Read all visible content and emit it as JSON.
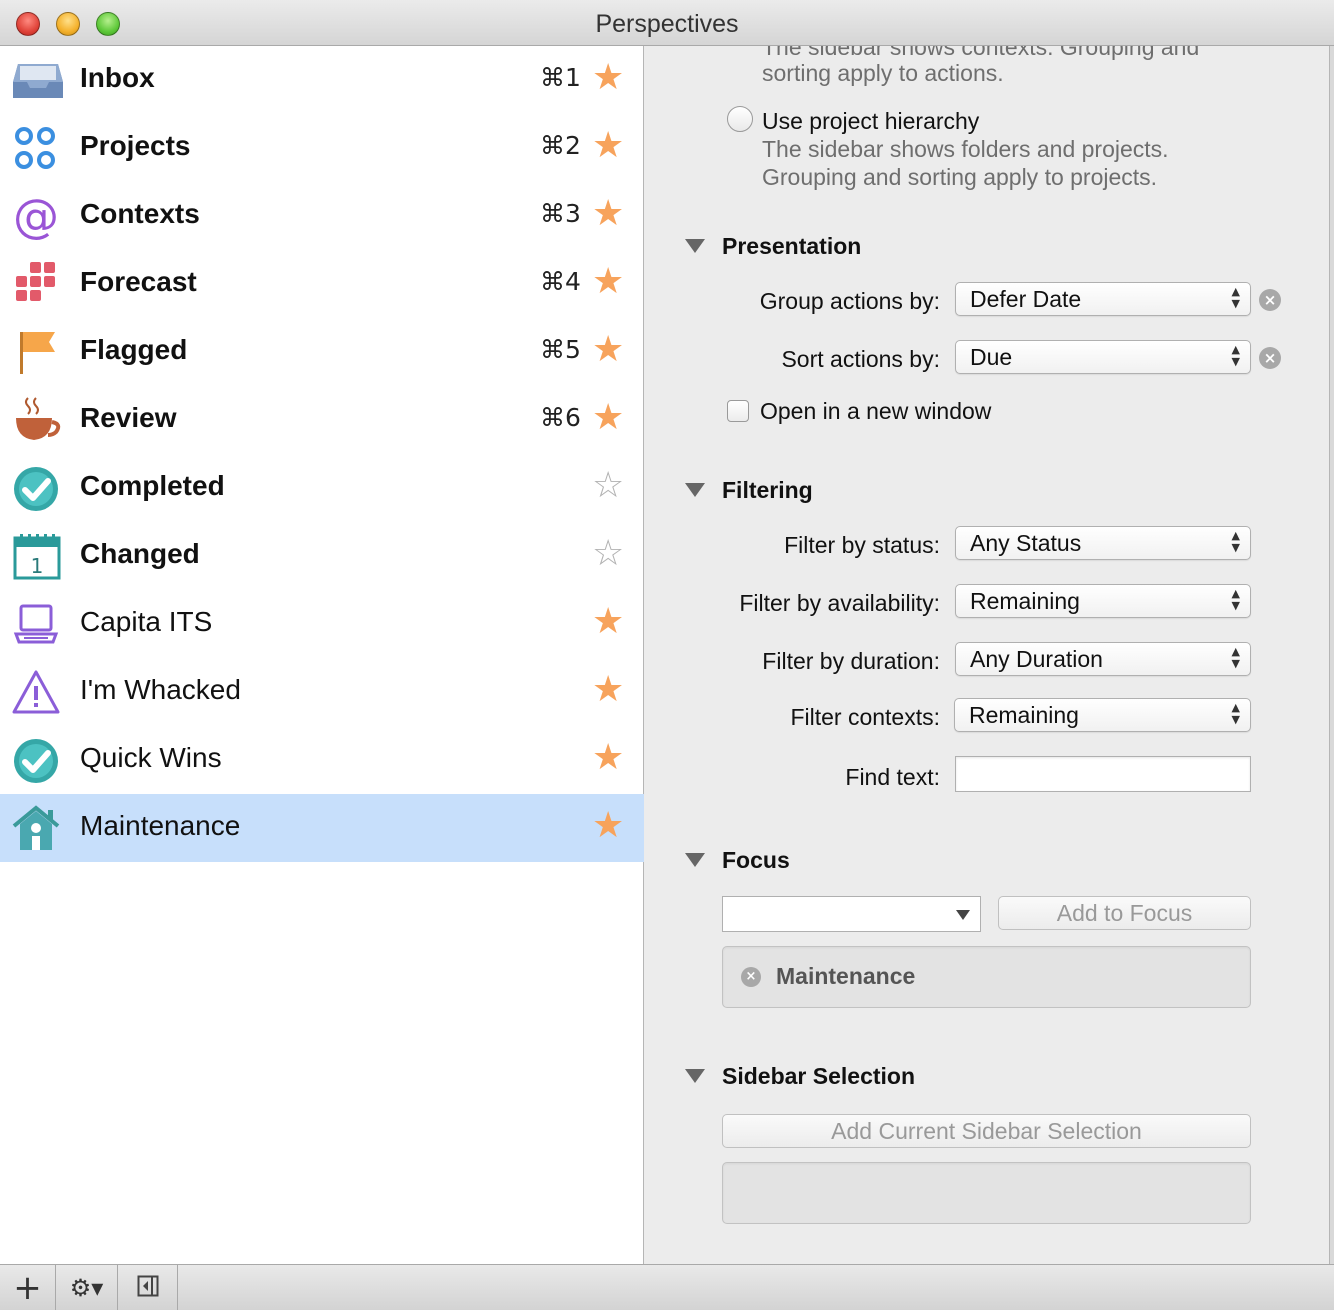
{
  "window": {
    "title": "Perspectives"
  },
  "perspectives": [
    {
      "label": "Inbox",
      "shortcut": "⌘1",
      "favorite": true,
      "bold": true,
      "icon": "inbox-icon",
      "selected": false
    },
    {
      "label": "Projects",
      "shortcut": "⌘2",
      "favorite": true,
      "bold": true,
      "icon": "projects-icon",
      "selected": false
    },
    {
      "label": "Contexts",
      "shortcut": "⌘3",
      "favorite": true,
      "bold": true,
      "icon": "contexts-icon",
      "selected": false
    },
    {
      "label": "Forecast",
      "shortcut": "⌘4",
      "favorite": true,
      "bold": true,
      "icon": "forecast-icon",
      "selected": false
    },
    {
      "label": "Flagged",
      "shortcut": "⌘5",
      "favorite": true,
      "bold": true,
      "icon": "flag-icon",
      "selected": false
    },
    {
      "label": "Review",
      "shortcut": "⌘6",
      "favorite": true,
      "bold": true,
      "icon": "review-cup-icon",
      "selected": false
    },
    {
      "label": "Completed",
      "shortcut": "",
      "favorite": false,
      "bold": true,
      "icon": "completed-check-icon",
      "selected": false
    },
    {
      "label": "Changed",
      "shortcut": "",
      "favorite": false,
      "bold": true,
      "icon": "calendar-icon",
      "selected": false
    },
    {
      "label": "Capita ITS",
      "shortcut": "",
      "favorite": true,
      "bold": false,
      "icon": "laptop-icon",
      "selected": false
    },
    {
      "label": "I'm Whacked",
      "shortcut": "",
      "favorite": true,
      "bold": false,
      "icon": "warning-icon",
      "selected": false
    },
    {
      "label": "Quick Wins",
      "shortcut": "",
      "favorite": true,
      "bold": false,
      "icon": "check-circle-icon",
      "selected": false
    },
    {
      "label": "Maintenance",
      "shortcut": "",
      "favorite": true,
      "bold": false,
      "icon": "house-icon",
      "selected": true
    }
  ],
  "stars": {
    "filled": "★",
    "empty": "☆"
  },
  "hierarchy": {
    "context_desc_line1": "The sidebar shows contexts. Grouping and",
    "context_desc_line2": "sorting apply to actions.",
    "project_label": "Use project hierarchy",
    "project_desc_line1": "The sidebar shows folders and projects.",
    "project_desc_line2": "Grouping and sorting apply to projects."
  },
  "presentation": {
    "heading": "Presentation",
    "group_label": "Group actions by:",
    "group_value": "Defer Date",
    "sort_label": "Sort actions by:",
    "sort_value": "Due",
    "open_new_window_label": "Open in a new window",
    "open_new_window_checked": false
  },
  "filtering": {
    "heading": "Filtering",
    "status_label": "Filter by status:",
    "status_value": "Any Status",
    "availability_label": "Filter by availability:",
    "availability_value": "Remaining",
    "duration_label": "Filter by duration:",
    "duration_value": "Any Duration",
    "contexts_label": "Filter contexts:",
    "contexts_value": "Remaining",
    "find_label": "Find text:",
    "find_value": ""
  },
  "focus": {
    "heading": "Focus",
    "combo_value": "",
    "add_button": "Add to Focus",
    "items": [
      "Maintenance"
    ]
  },
  "sidebar_selection": {
    "heading": "Sidebar Selection",
    "add_button": "Add Current Sidebar Selection"
  },
  "colors": {
    "star": "#f7a35c",
    "selected_row": "#c7dffb"
  }
}
